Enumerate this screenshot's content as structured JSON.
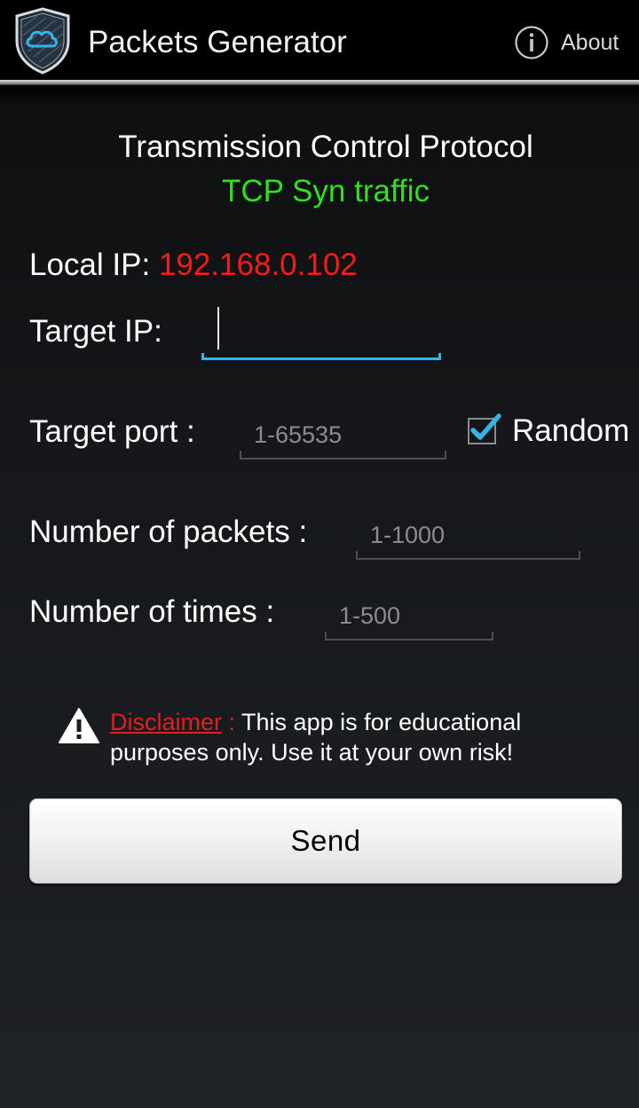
{
  "actionbar": {
    "title": "Packets Generator",
    "about_label": "About"
  },
  "header": {
    "protocol": "Transmission Control Protocol",
    "traffic": "TCP Syn traffic"
  },
  "form": {
    "local_ip_label": "Local IP:",
    "local_ip_value": "192.168.0.102",
    "target_ip_label": "Target IP:",
    "target_ip_value": "",
    "target_port_label": "Target port :",
    "target_port_placeholder": "1-65535",
    "target_port_value": "",
    "random_label": "Random",
    "random_checked": true,
    "packets_label": "Number of packets :",
    "packets_placeholder": "1-1000",
    "packets_value": "",
    "times_label": "Number of times :",
    "times_placeholder": "1-500",
    "times_value": ""
  },
  "disclaimer": {
    "link_label": "Disclaimer",
    "separator": " :",
    "text": " This app is for educational purposes only. Use it at your own risk!"
  },
  "send_button": {
    "label": "Send"
  },
  "icons": {
    "app_icon": "shield-cloud-icon",
    "about_icon": "info-circle-icon",
    "warning_icon": "warning-triangle-icon",
    "checkbox_icon": "checkmark-icon"
  },
  "colors": {
    "accent_blue": "#33b5e5",
    "local_ip_red": "#ff1a1a",
    "traffic_green": "#33dd22",
    "disclaimer_red": "#e02020"
  }
}
